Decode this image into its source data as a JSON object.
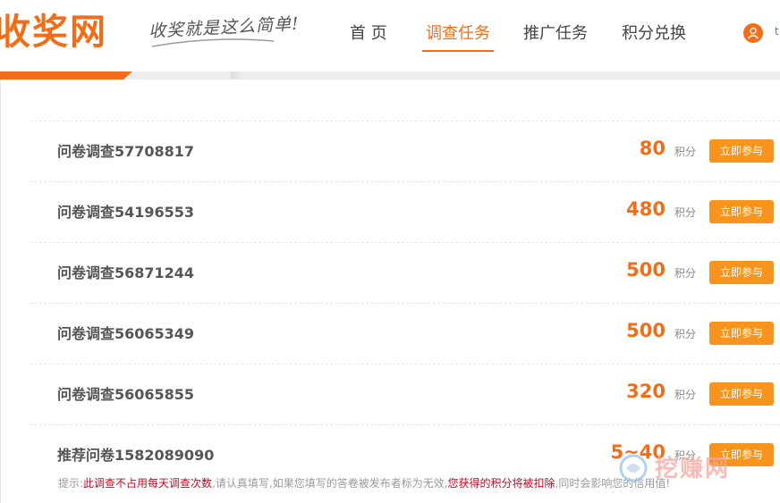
{
  "header": {
    "logo": "收奖网",
    "slogan": "收奖就是这么简单!",
    "nav": [
      {
        "label": "首 页",
        "active": false
      },
      {
        "label": "调查任务",
        "active": true
      },
      {
        "label": "推广任务",
        "active": false
      },
      {
        "label": "积分兑换",
        "active": false
      }
    ],
    "user_icon": "user-icon",
    "extra": "t"
  },
  "tasks": [
    {
      "title": "问卷调查57708817",
      "points": "80",
      "unit": "积分",
      "button": "立即参与"
    },
    {
      "title": "问卷调查54196553",
      "points": "480",
      "unit": "积分",
      "button": "立即参与"
    },
    {
      "title": "问卷调查56871244",
      "points": "500",
      "unit": "积分",
      "button": "立即参与"
    },
    {
      "title": "问卷调查56065349",
      "points": "500",
      "unit": "积分",
      "button": "立即参与"
    },
    {
      "title": "问卷调查56065855",
      "points": "320",
      "unit": "积分",
      "button": "立即参与"
    },
    {
      "title": "推荐问卷1582089090",
      "points": "5~40",
      "unit": "积分",
      "button": "立即参与"
    }
  ],
  "tip": {
    "prefix": "提示:",
    "red1": "此调查不占用每天调查次数",
    "mid": ",请认真填写,如果您填写的答卷被发布者标为无效,",
    "red2": "您获得的积分将被扣除",
    "suffix": ",同时会影响您的信用值!"
  },
  "watermark": "挖赚网",
  "colors": {
    "accent": "#f26d1a",
    "button": "#f7941d",
    "tip_red": "#d0021b"
  }
}
